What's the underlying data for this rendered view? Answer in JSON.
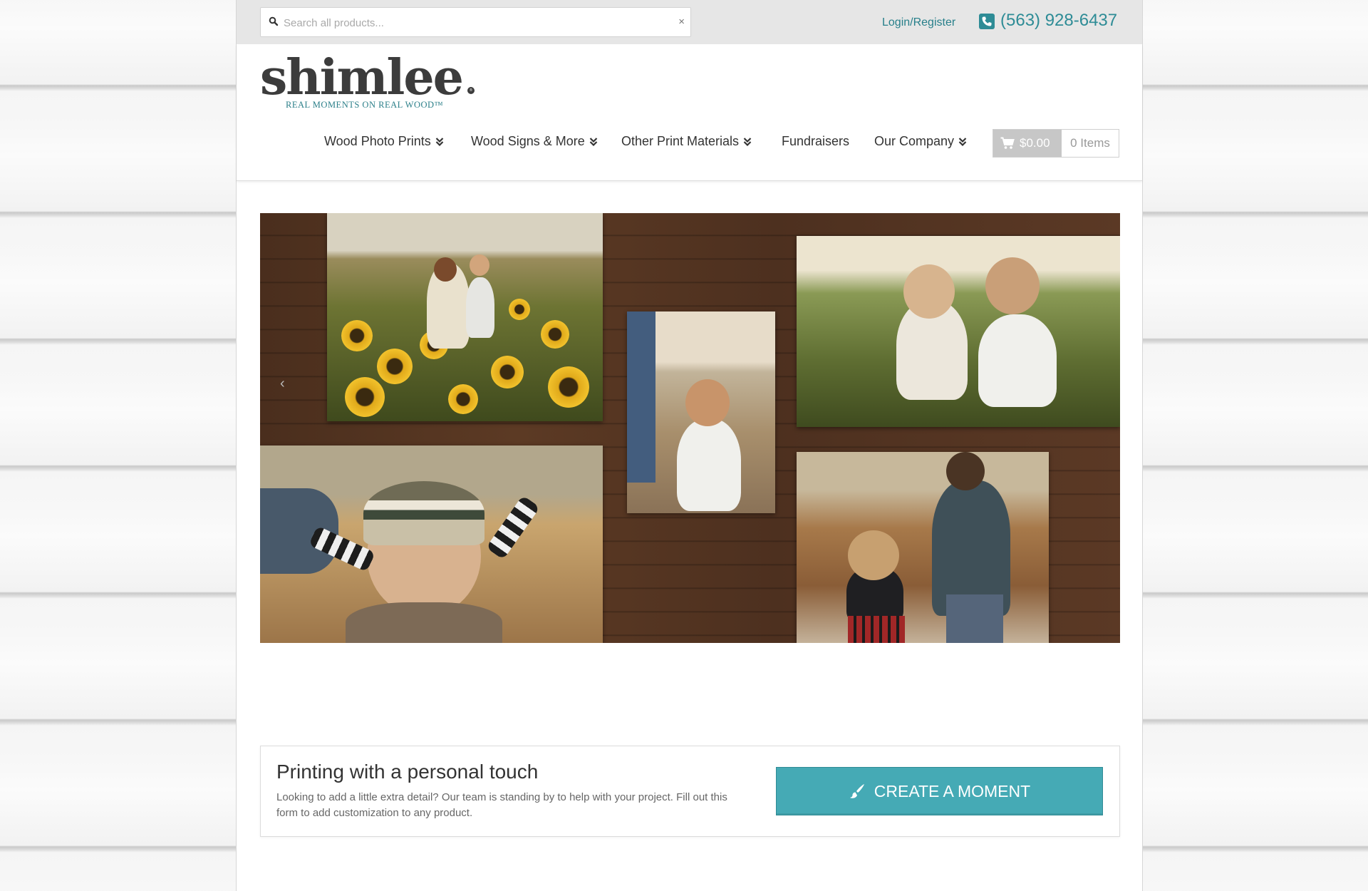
{
  "search": {
    "placeholder": "Search all products...",
    "clear": "×"
  },
  "topbar": {
    "login": "Login/Register",
    "phone": "(563) 928-6437"
  },
  "logo": {
    "word": "shimlee",
    "registered": "®",
    "tagline": "REAL MOMENTS ON REAL WOOD™"
  },
  "nav": {
    "items": [
      {
        "label": "Wood Photo Prints",
        "dropdown": true
      },
      {
        "label": "Wood Signs & More",
        "dropdown": true
      },
      {
        "label": "Other Print Materials",
        "dropdown": true
      },
      {
        "label": "Fundraisers",
        "dropdown": false
      },
      {
        "label": "Our Company",
        "dropdown": true
      }
    ]
  },
  "cart": {
    "total": "$0.00",
    "items": "0 Items"
  },
  "hero": {
    "prev_arrow": "‹"
  },
  "cta": {
    "title": "Printing with a personal touch",
    "text": "Looking to add a little extra detail? Our team is standing by to help with your project. Fill out this form to add customization to any product.",
    "button": "CREATE A MOMENT"
  },
  "colors": {
    "accent": "#45aab5",
    "link": "#277f8a",
    "phone": "#2e8c96"
  },
  "icons": [
    "search-icon",
    "close-icon",
    "phone-icon",
    "chevron-down-icon",
    "cart-icon",
    "brush-icon"
  ]
}
